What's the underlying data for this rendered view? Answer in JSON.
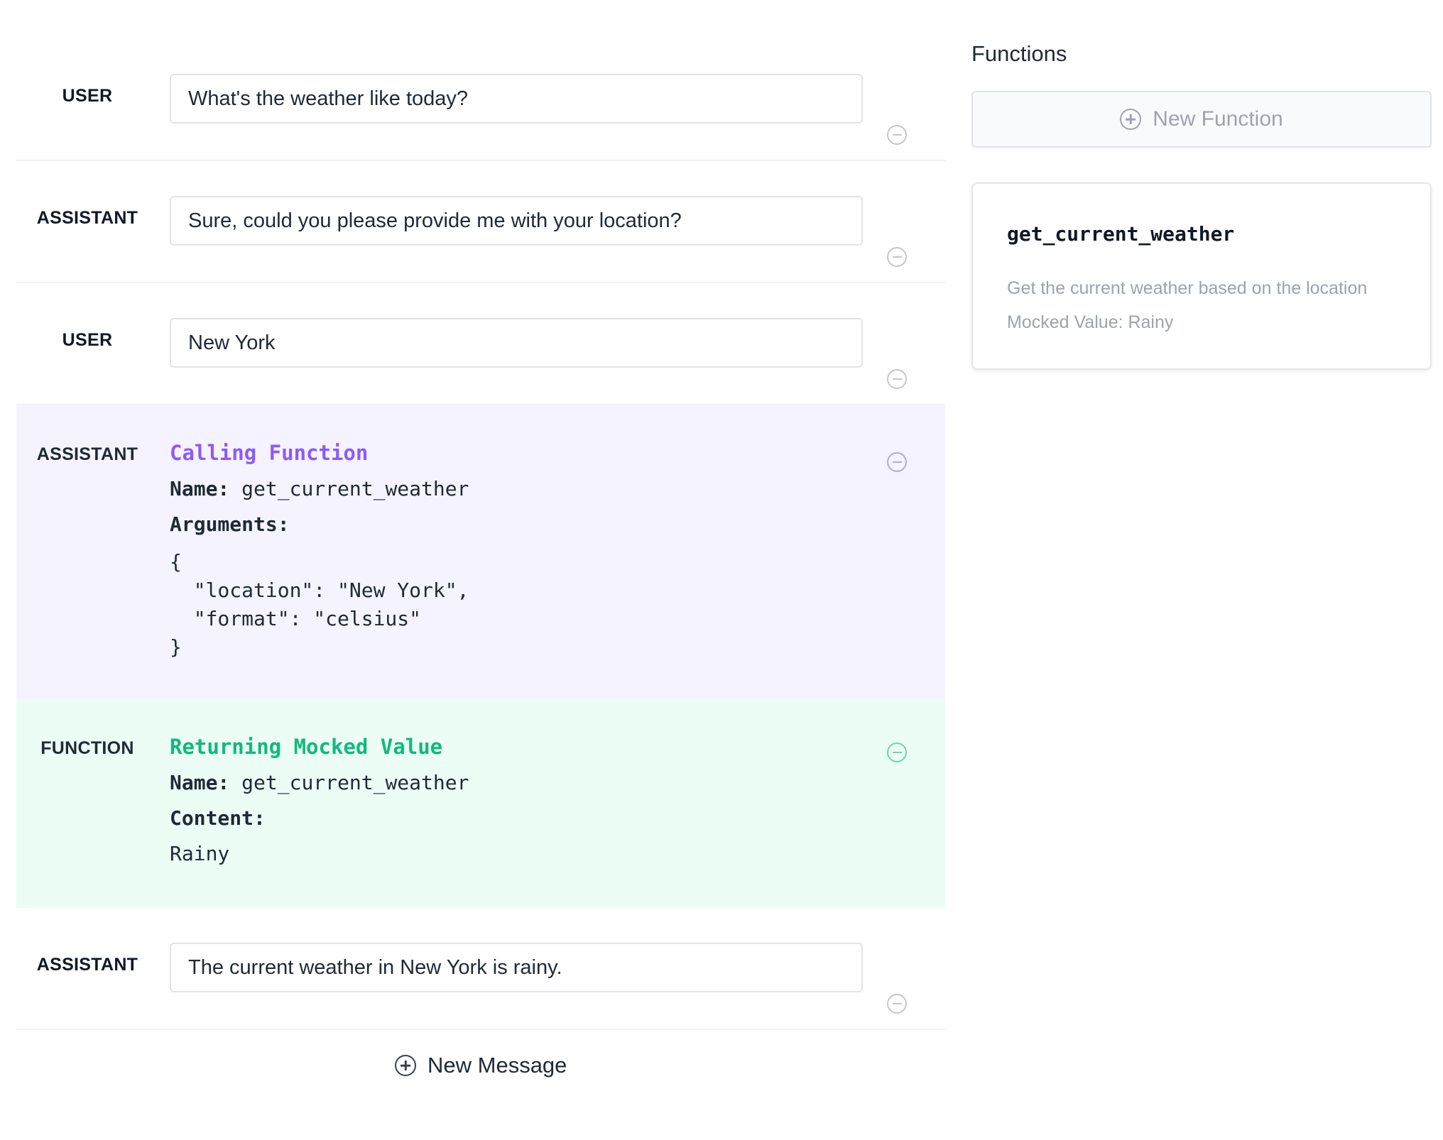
{
  "messages": [
    {
      "role": "USER",
      "content": "What's the weather like today?"
    },
    {
      "role": "ASSISTANT",
      "content": "Sure, could you please provide me with your location?"
    },
    {
      "role": "USER",
      "content": "New York"
    },
    {
      "role": "ASSISTANT",
      "heading": "Calling Function",
      "name_label": "Name:",
      "name_value": "get_current_weather",
      "arguments_label": "Arguments:",
      "arguments": "{\n  \"location\": \"New York\",\n  \"format\": \"celsius\"\n}"
    },
    {
      "role": "FUNCTION",
      "heading": "Returning Mocked Value",
      "name_label": "Name:",
      "name_value": "get_current_weather",
      "content_label": "Content:",
      "content": "Rainy"
    },
    {
      "role": "ASSISTANT",
      "content": "The current weather in New York is rainy."
    }
  ],
  "new_message_label": "New Message",
  "functions_panel": {
    "title": "Functions",
    "new_function_label": "New Function",
    "functions": [
      {
        "name": "get_current_weather",
        "description": "Get the current weather based on the location",
        "mocked_value": "Mocked Value: Rainy"
      }
    ]
  },
  "colors": {
    "call_background": "#f5f3ff",
    "call_accent": "#8b5cf6",
    "function_background": "#ecfdf5",
    "function_accent": "#10b981"
  },
  "icons": {
    "remove": "minus-circle-icon",
    "add": "plus-circle-icon"
  }
}
